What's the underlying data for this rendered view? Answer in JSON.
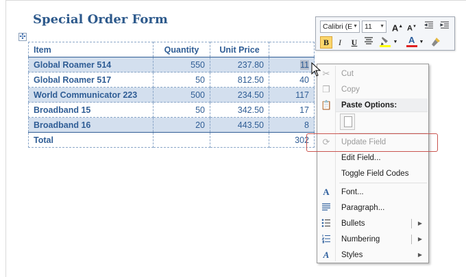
{
  "document": {
    "title": "Special Order Form"
  },
  "table": {
    "headers": [
      "Item",
      "Quantity",
      "Unit Price",
      ""
    ],
    "rows": [
      {
        "item": "Global Roamer 514",
        "quantity": "550",
        "unit_price": "237.80",
        "total": "11"
      },
      {
        "item": "Global Roamer 517",
        "quantity": "50",
        "unit_price": "812.50",
        "total": "40"
      },
      {
        "item": "World Communicator 223",
        "quantity": "500",
        "unit_price": "234.50",
        "total": "117"
      },
      {
        "item": "Broadband 15",
        "quantity": "50",
        "unit_price": "342.50",
        "total": "17"
      },
      {
        "item": "Broadband 16",
        "quantity": "20",
        "unit_price": "443.50",
        "total": "8"
      }
    ],
    "total_row": {
      "label": "Total",
      "total": "302"
    }
  },
  "mini_toolbar": {
    "font_name": "Calibri (E",
    "font_size": "11",
    "grow_font_icon": "grow-font-icon",
    "shrink_font_icon": "shrink-font-icon",
    "decrease_indent_icon": "decrease-indent-icon",
    "increase_indent_icon": "increase-indent-icon",
    "bold": "B",
    "italic": "I",
    "underline": "U",
    "highlight_color": "#ffff00",
    "font_color": "#e02020",
    "format_painter_icon": "format-painter-icon"
  },
  "context_menu": {
    "cut": "Cut",
    "copy": "Copy",
    "paste_options_header": "Paste Options:",
    "update_field": "Update Field",
    "edit_field": "Edit Field...",
    "toggle_field_codes": "Toggle Field Codes",
    "font": "Font...",
    "paragraph": "Paragraph...",
    "bullets": "Bullets",
    "numbering": "Numbering",
    "styles": "Styles"
  },
  "highlight_box_color": "#c9544f"
}
